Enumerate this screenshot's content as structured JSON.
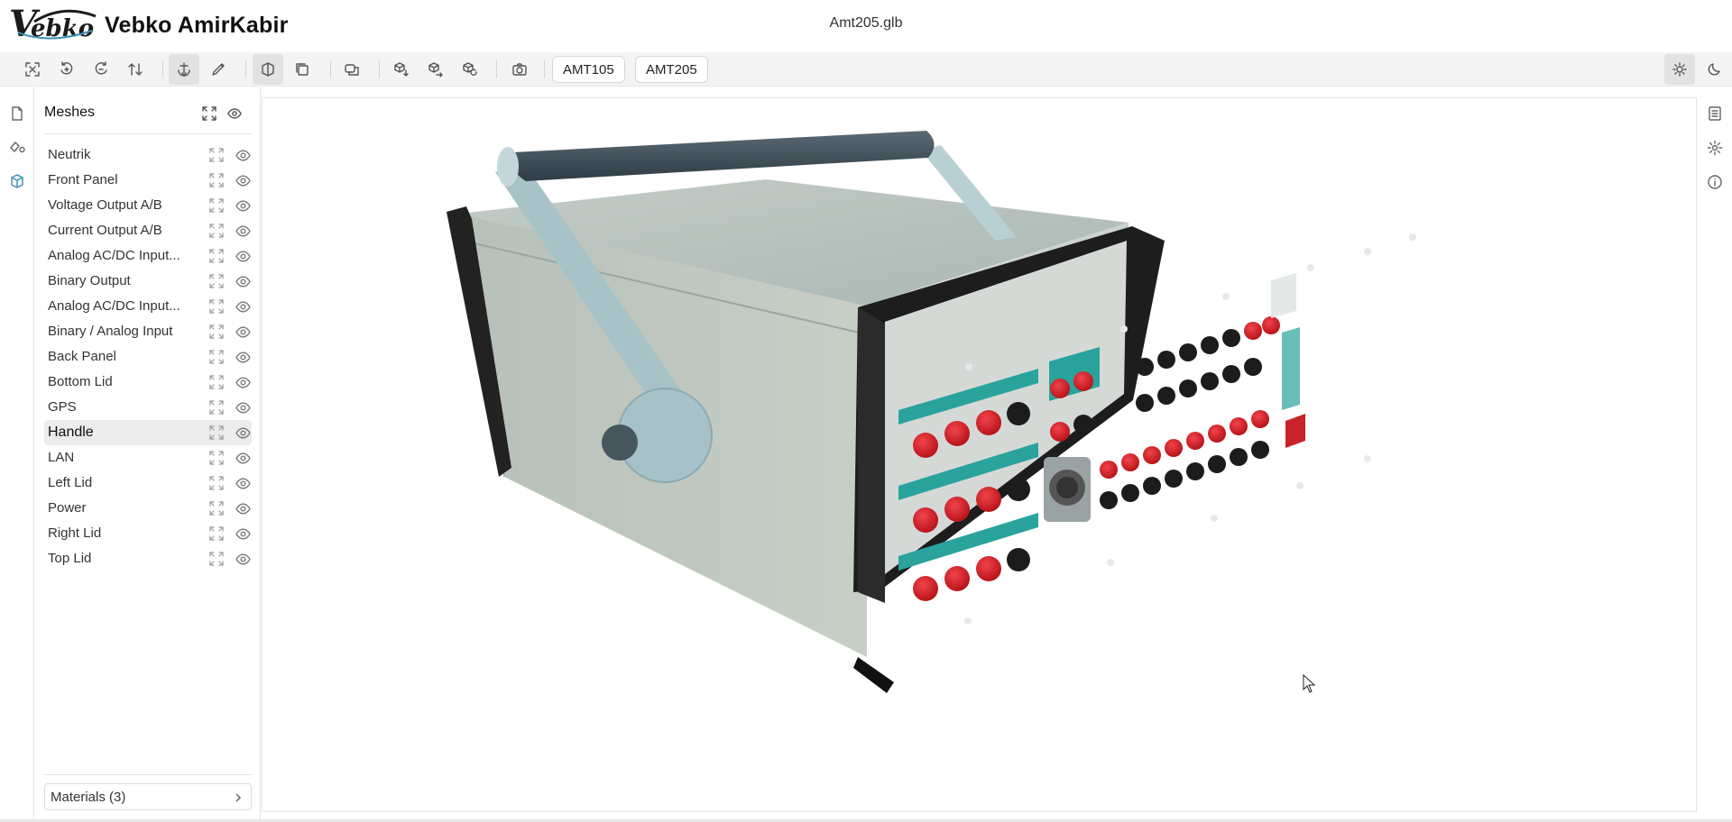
{
  "header": {
    "brand_name": "Vebko AmirKabir",
    "logo_text": "Vebko",
    "file_name": "Amt205.glb"
  },
  "toolbar": {
    "view_buttons": [
      "fit-view-icon",
      "rotate-left-icon",
      "rotate-right-icon",
      "flip-vertical-icon"
    ],
    "model_buttons": [
      {
        "label": "AMT105"
      },
      {
        "label": "AMT205"
      }
    ]
  },
  "left_rail": [
    "file-icon",
    "shapes-icon",
    "cube-icon"
  ],
  "meshes_panel": {
    "title": "Meshes",
    "items": [
      {
        "label": "Neutrik"
      },
      {
        "label": "Front Panel"
      },
      {
        "label": "Voltage Output A/B"
      },
      {
        "label": "Current Output A/B"
      },
      {
        "label": "Analog AC/DC Input..."
      },
      {
        "label": "Binary Output"
      },
      {
        "label": "Analog AC/DC Input..."
      },
      {
        "label": "Binary / Analog Input"
      },
      {
        "label": "Back Panel"
      },
      {
        "label": "Bottom Lid"
      },
      {
        "label": "GPS"
      },
      {
        "label": "Handle",
        "selected": true
      },
      {
        "label": "LAN"
      },
      {
        "label": "Left Lid"
      },
      {
        "label": "Power"
      },
      {
        "label": "Right Lid"
      },
      {
        "label": "Top Lid"
      }
    ],
    "materials_label": "Materials (3)"
  },
  "right_rail": [
    "list-icon",
    "gear-icon",
    "info-icon"
  ],
  "colors": {
    "accent": "#3a8fb5",
    "body": "#b9c4bd",
    "frame": "#1e1e1e",
    "handle_bar": "#3f4d57",
    "handle_arm": "#aac6cd",
    "jack_red": "#d81820",
    "jack_black": "#1c1c1c",
    "label_teal": "#2aa39d"
  }
}
